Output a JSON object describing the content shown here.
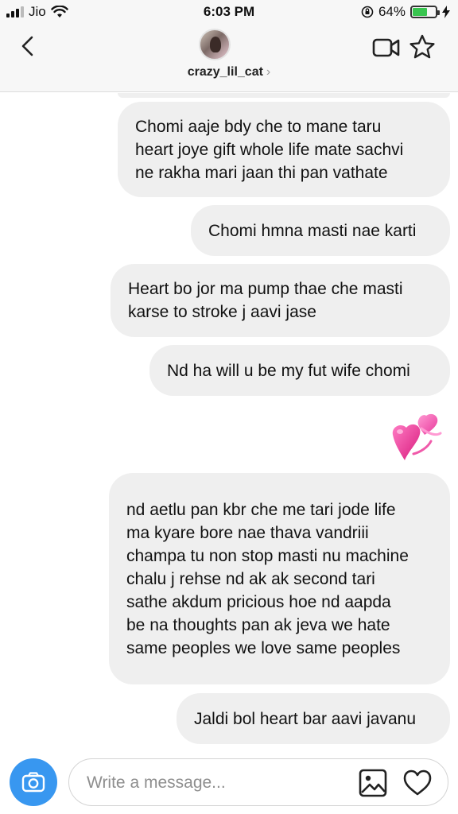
{
  "status_bar": {
    "carrier": "Jio",
    "time": "6:03 PM",
    "battery_percent": "64%",
    "battery_level": 0.64
  },
  "header": {
    "username": "crazy_lil_cat",
    "username_chevron": "›",
    "icons": [
      "back-arrow-icon",
      "video-camera-icon",
      "star-icon"
    ]
  },
  "messages": [
    {
      "text": "Chomi aaje bdy che to mane taru\nheart joye gift whole life mate sachvi\nne rakha mari jaan thi pan vathate"
    },
    {
      "text": "Chomi hmna masti nae karti"
    },
    {
      "text": "Heart bo jor ma pump thae che masti\nkarse to stroke j aavi jase"
    },
    {
      "text": "Nd ha will u be my fut wife chomi"
    },
    {
      "emoji": "two-hearts-icon"
    },
    {
      "text": "nd aetlu pan kbr che me tari jode life\nma kyare bore nae thava vandriii\nchampa tu non stop masti nu machine\nchalu j rehse nd ak ak second tari\nsathe akdum pricious hoe nd aapda\nbe na thoughts pan ak jeva we hate\nsame peoples we love same peoples"
    },
    {
      "text": "Jaldi bol heart bar aavi javanu"
    }
  ],
  "composer": {
    "placeholder": "Write a message...",
    "value": "",
    "icons": [
      "camera-icon",
      "gallery-icon",
      "heart-icon"
    ]
  },
  "colors": {
    "accent": "#3897f0",
    "bubble": "#efefef",
    "battery": "#38c54f",
    "emoji_pink": "#e8389b"
  }
}
